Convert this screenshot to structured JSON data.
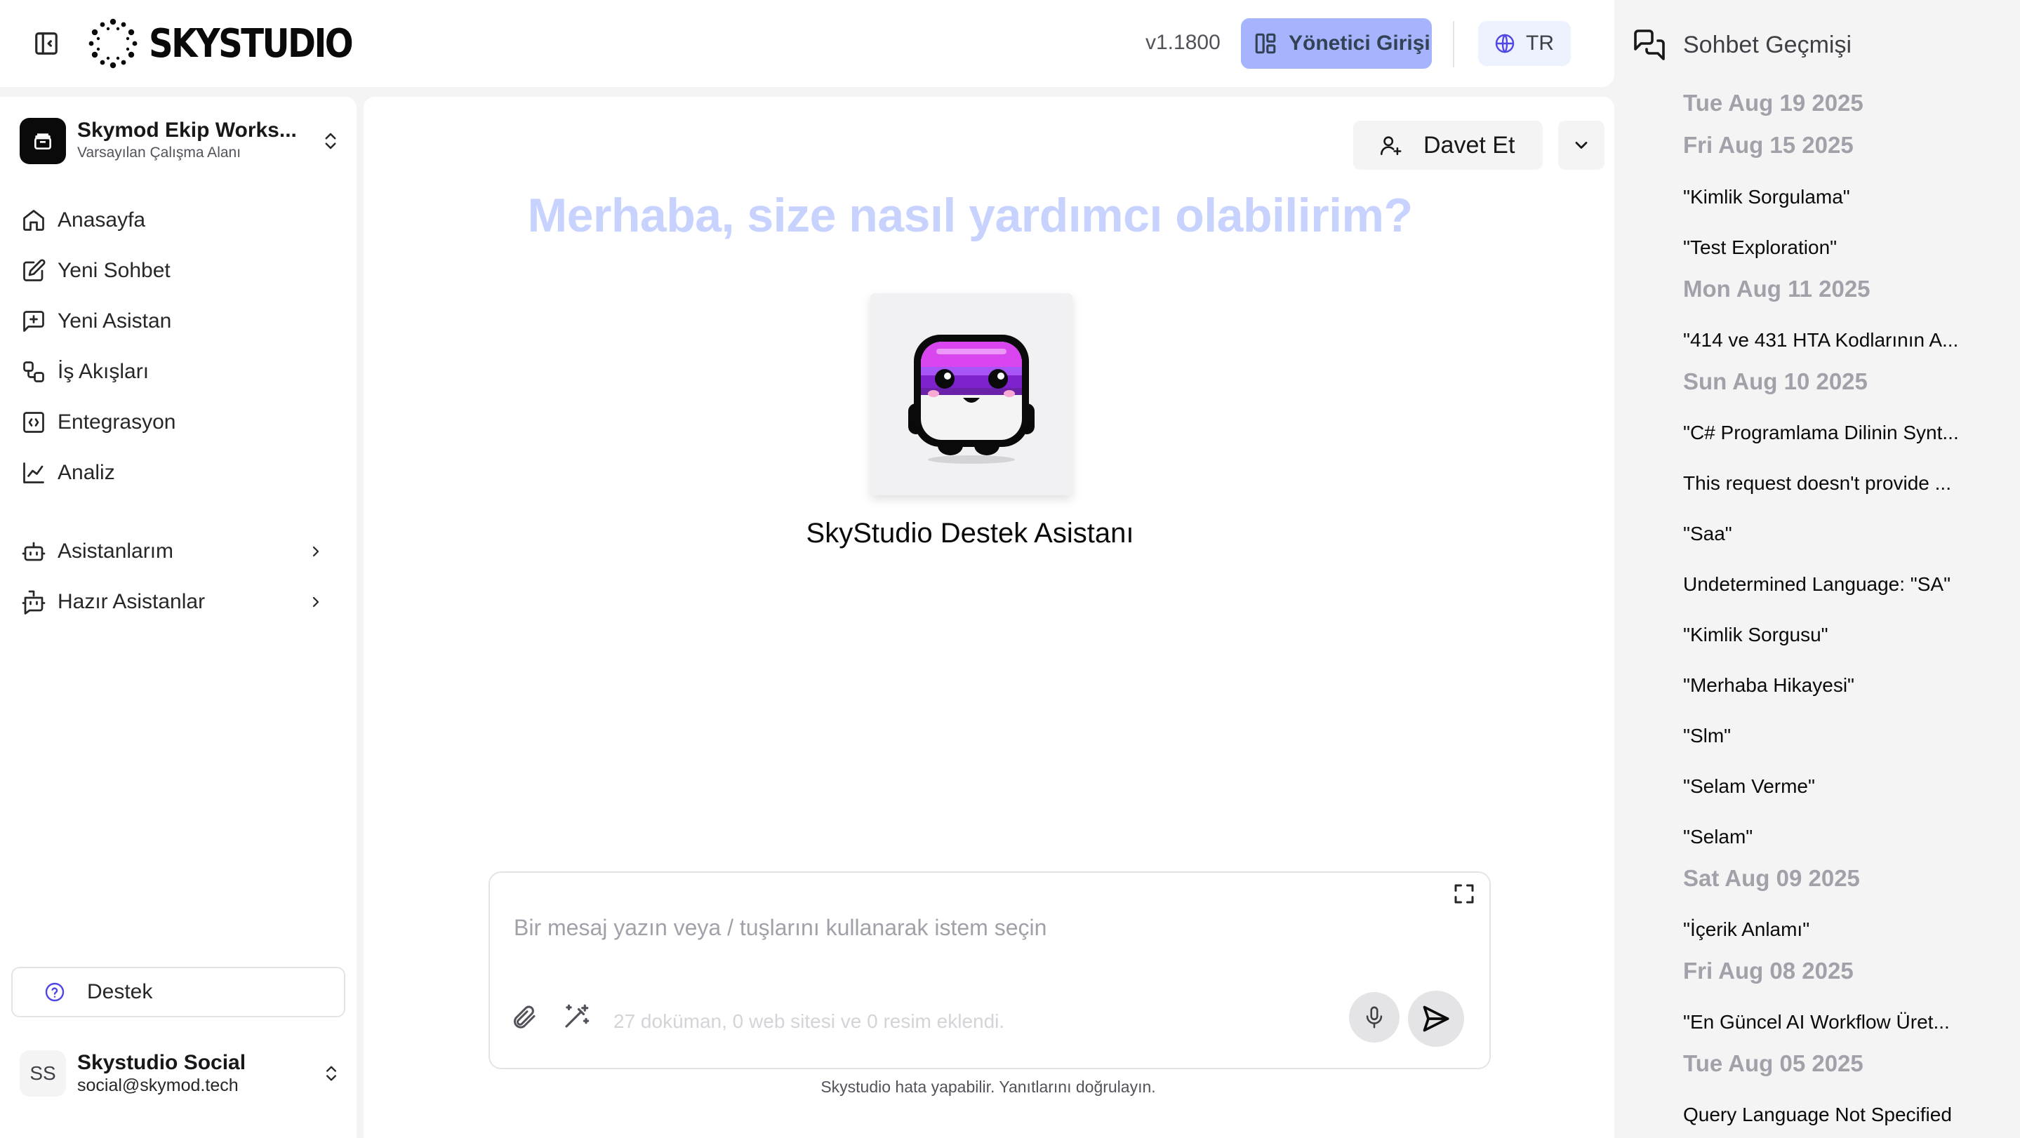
{
  "header": {
    "logo_text": "SKYSTUDIO",
    "version": "v1.1800",
    "admin_label": "Yönetici Girişi",
    "language": "TR"
  },
  "sidebar": {
    "workspace_name": "Skymod Ekip Works...",
    "workspace_sub": "Varsayılan Çalışma Alanı",
    "nav": [
      {
        "label": "Anasayfa",
        "icon": "home-icon"
      },
      {
        "label": "Yeni Sohbet",
        "icon": "edit-icon"
      },
      {
        "label": "Yeni Asistan",
        "icon": "message-plus-icon"
      },
      {
        "label": "İş Akışları",
        "icon": "workflow-icon"
      },
      {
        "label": "Entegrasyon",
        "icon": "integration-icon"
      },
      {
        "label": "Analiz",
        "icon": "chart-line-icon"
      }
    ],
    "groups": [
      {
        "label": "Asistanlarım",
        "icon": "bot-icon"
      },
      {
        "label": "Hazır Asistanlar",
        "icon": "bot-message-icon"
      }
    ],
    "support_label": "Destek",
    "user_initials": "SS",
    "user_name": "Skystudio Social",
    "user_email": "social@skymod.tech"
  },
  "main": {
    "invite_label": "Davet Et",
    "greeting": "Merhaba, size nasıl yardımcı olabilirim?",
    "assistant_name": "SkyStudio Destek Asistanı",
    "input_placeholder": "Bir mesaj yazın veya / tuşlarını kullanarak istem seçin",
    "doc_status": "27 doküman, 0 web sitesi ve 0 resim eklendi.",
    "disclaimer": "Skystudio hata yapabilir. Yanıtlarını doğrulayın."
  },
  "history": {
    "title": "Sohbet Geçmişi",
    "groups": [
      {
        "date": "Tue Aug 19 2025",
        "items": []
      },
      {
        "date": "Fri Aug 15 2025",
        "items": [
          "\"Kimlik Sorgulama\"",
          "\"Test Exploration\""
        ]
      },
      {
        "date": "Mon Aug 11 2025",
        "items": [
          "\"414 ve 431 HTA Kodlarının A..."
        ]
      },
      {
        "date": "Sun Aug 10 2025",
        "items": [
          "\"C# Programlama Dilinin Synt...",
          "This request doesn't provide ...",
          "\"Saa\"",
          "Undetermined Language: \"SA\"",
          "\"Kimlik Sorgusu\"",
          "\"Merhaba Hikayesi\"",
          "\"Slm\"",
          "\"Selam Verme\"",
          "\"Selam\""
        ]
      },
      {
        "date": "Sat Aug 09 2025",
        "items": [
          "\"İçerik Anlamı\""
        ]
      },
      {
        "date": "Fri Aug 08 2025",
        "items": [
          "\"En Güncel AI Workflow Üret..."
        ]
      },
      {
        "date": "Tue Aug 05 2025",
        "items": [
          "Query Language Not Specified"
        ]
      }
    ]
  },
  "colors": {
    "accent": "#a5b4fc",
    "greeting": "#c7d2fe",
    "background": "#f4f4f5"
  }
}
